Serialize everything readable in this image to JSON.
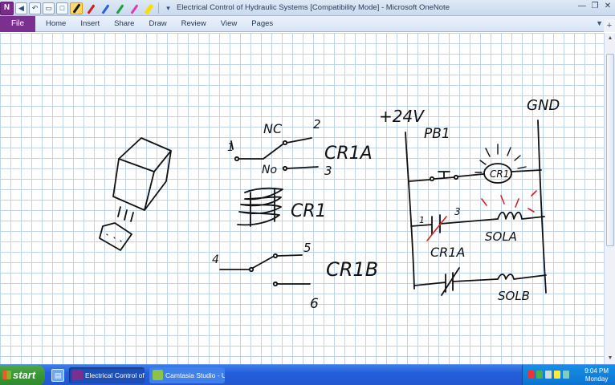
{
  "window": {
    "title": "Electrical Control of Hydraulic Systems [Compatibility Mode] - Microsoft OneNote",
    "app_icon_label": "N"
  },
  "toolbar": {
    "pen_colors": [
      "#1a1a1a",
      "#d91a1a",
      "#2a5fd6",
      "#1e9e3a",
      "#e03ab4"
    ],
    "highlighter_color": "#f7e000"
  },
  "ribbon": {
    "file_label": "File",
    "tabs": [
      "Home",
      "Insert",
      "Share",
      "Draw",
      "Review",
      "View",
      "Pages"
    ]
  },
  "canvas": {
    "ink_color": "#111111",
    "mark_color": "#d42020",
    "labels": {
      "nc": "NC",
      "no": "No",
      "contact_1": "1",
      "contact_2": "2",
      "contact_3": "3",
      "cr1a_left": "CR1A",
      "cr1_coil_left": "CR1",
      "contact_4": "4",
      "contact_5": "5",
      "contact_6": "6",
      "cr1b_left": "CR1B",
      "supply": "+24V",
      "gnd": "GND",
      "pb1": "PB1",
      "cr1_lamp": "CR1",
      "rung2_1": "1",
      "rung2_3": "3",
      "sola": "SOLA",
      "cr1a_rung": "CR1A",
      "solb": "SOLB"
    }
  },
  "taskbar": {
    "start_label": "start",
    "tasks": [
      "Electrical Control of...",
      "Camtasia Studio - U..."
    ],
    "time": "9:04 PM",
    "day": "Monday"
  }
}
